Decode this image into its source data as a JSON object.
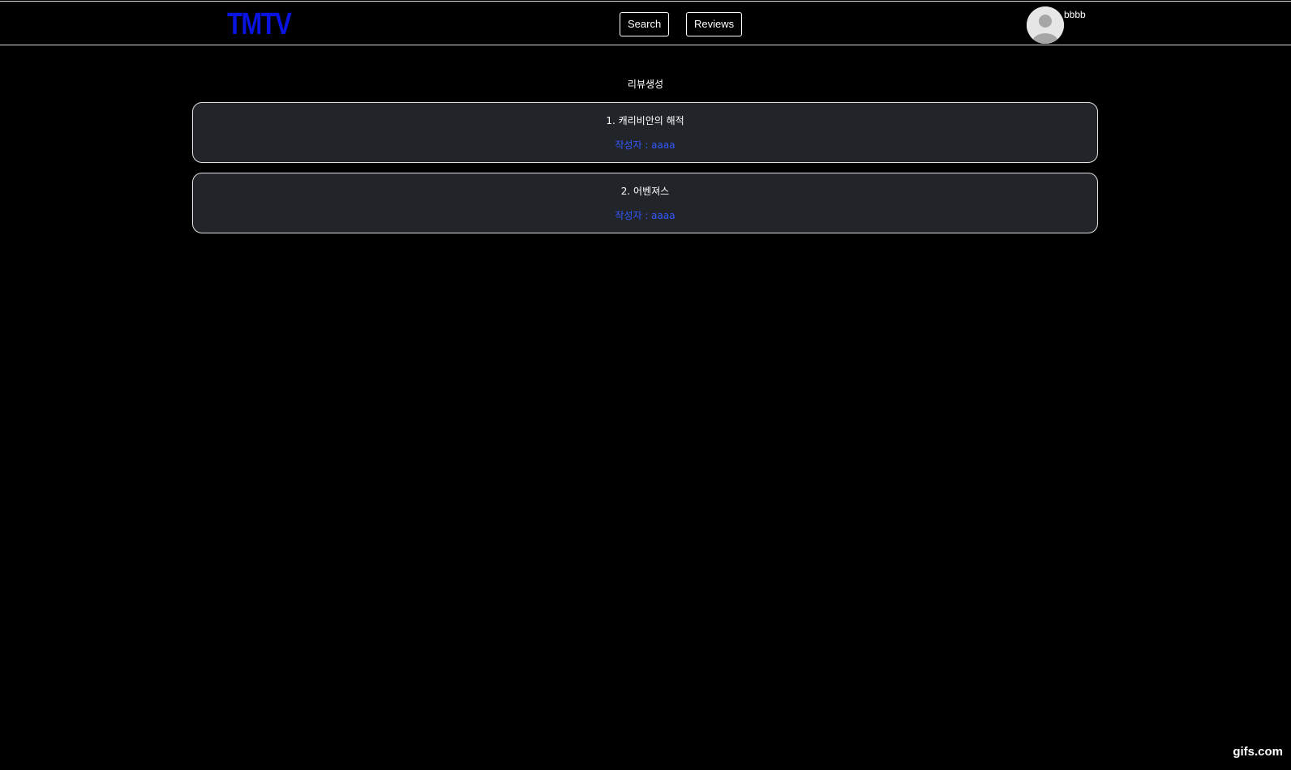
{
  "navbar": {
    "logo": "TMTV",
    "search_label": "Search",
    "reviews_label": "Reviews",
    "username": "bbbb",
    "avatar_icon": "user-avatar-icon"
  },
  "main": {
    "section_title": "리뷰생성",
    "reviews": [
      {
        "title": "1. 캐리비안의 해적",
        "author": "작성자 : aaaa"
      },
      {
        "title": "2. 어벤져스",
        "author": "작성자 : aaaa"
      }
    ]
  },
  "watermark": "gifs.com",
  "colors": {
    "background": "#000000",
    "logo": "#0a14e0",
    "card_background": "#212529",
    "author_link": "#3357ff"
  }
}
